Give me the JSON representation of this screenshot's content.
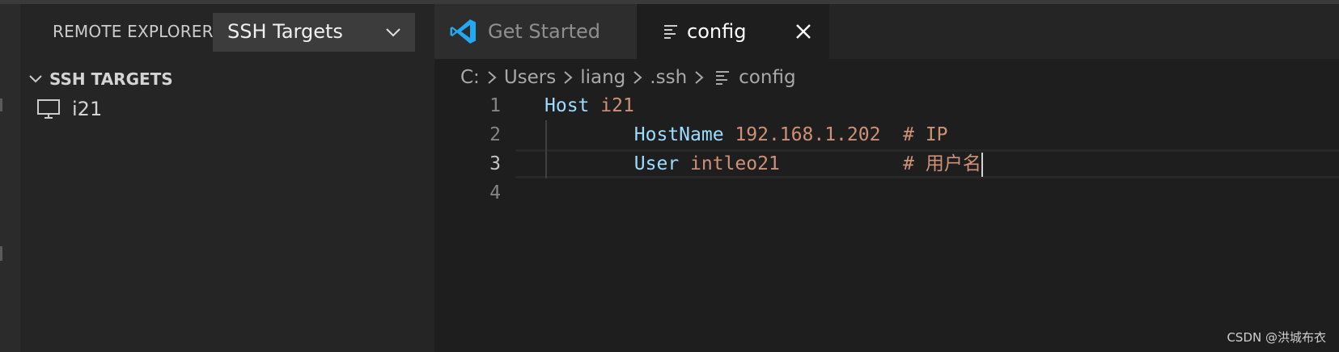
{
  "sidebar": {
    "title": "REMOTE EXPLORER",
    "target_select": "SSH Targets",
    "section_label": "SSH TARGETS",
    "items": [
      {
        "label": "i21"
      }
    ]
  },
  "tabs": [
    {
      "label": "Get Started"
    },
    {
      "label": "config"
    }
  ],
  "breadcrumb": [
    "C:",
    "Users",
    "liang",
    ".ssh",
    "config"
  ],
  "editor": {
    "lines": [
      {
        "num": "1",
        "indent": "",
        "key": "Host",
        "value": "i21",
        "pad": "",
        "comment": ""
      },
      {
        "num": "2",
        "indent": "        ",
        "key": "HostName",
        "value": "192.168.1.202",
        "pad": "  ",
        "comment": "# IP"
      },
      {
        "num": "3",
        "indent": "        ",
        "key": "User",
        "value": "intleo21",
        "pad": "           ",
        "comment": "# 用户名"
      },
      {
        "num": "4",
        "indent": "",
        "key": "",
        "value": "",
        "pad": "",
        "comment": ""
      }
    ]
  },
  "watermark": "CSDN @洪城布衣",
  "colors": {
    "accent_blue": "#23a9f2",
    "keyword": "#9cdcfe",
    "string": "#ce9178"
  }
}
